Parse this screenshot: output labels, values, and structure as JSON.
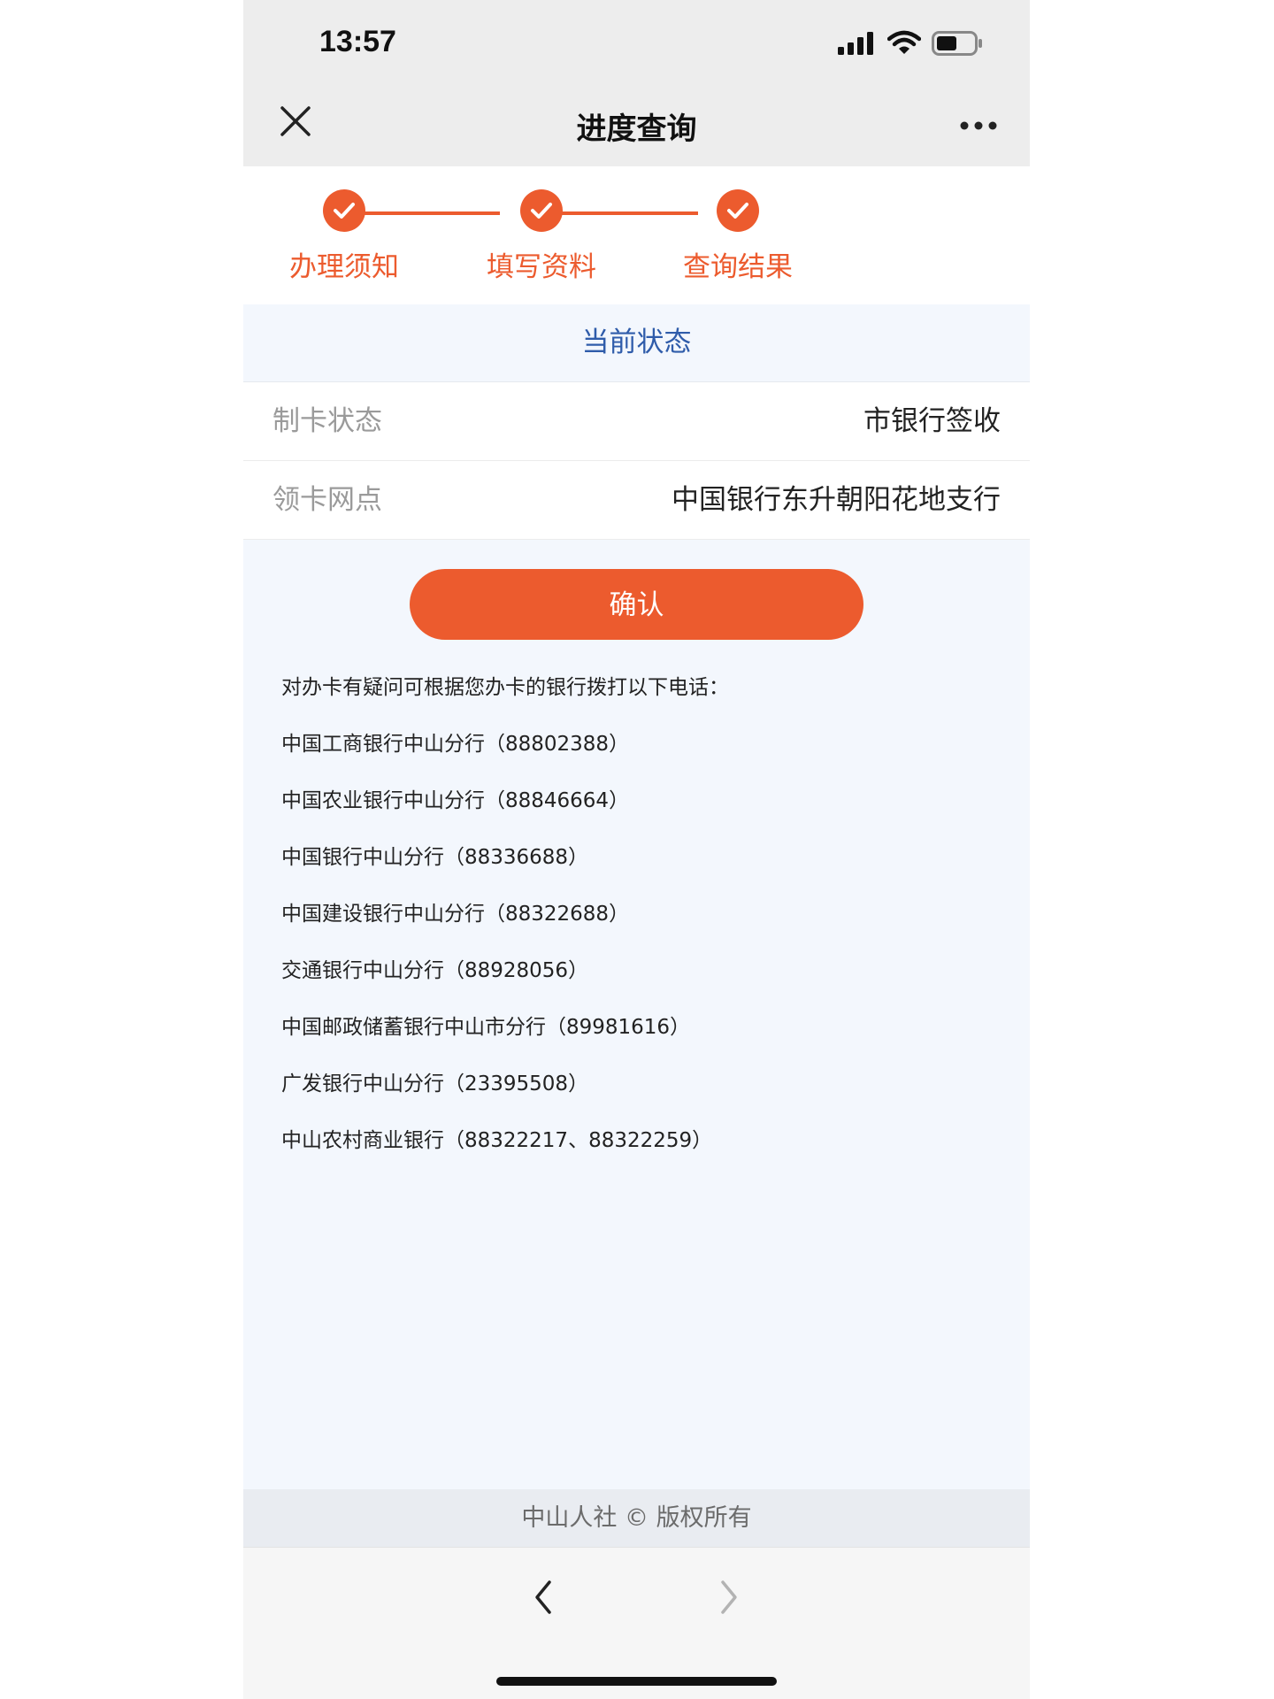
{
  "status_bar": {
    "time": "13:57"
  },
  "nav": {
    "title": "进度查询"
  },
  "steps": [
    {
      "label": "办理须知"
    },
    {
      "label": "填写资料"
    },
    {
      "label": "查询结果"
    }
  ],
  "status_section": {
    "header": "当前状态",
    "rows": [
      {
        "label": "制卡状态",
        "value": "市银行签收"
      },
      {
        "label": "领卡网点",
        "value": "中国银行东升朝阳花地支行"
      }
    ]
  },
  "confirm_label": "确认",
  "contacts": {
    "intro": "对办卡有疑问可根据您办卡的银行拨打以下电话：",
    "lines": [
      "中国工商银行中山分行（88802388）",
      "中国农业银行中山分行（88846664）",
      "中国银行中山分行（88336688）",
      "中国建设银行中山分行（88322688）",
      "交通银行中山分行（88928056）",
      "中国邮政储蓄银行中山市分行（89981616）",
      "广发银行中山分行（23395508）",
      "中山农村商业银行（88322217、88322259）"
    ]
  },
  "footer": "中山人社 © 版权所有",
  "colors": {
    "accent": "#ec5b2e",
    "link_blue": "#2f5caa",
    "page_bg": "#f3f7fd"
  }
}
